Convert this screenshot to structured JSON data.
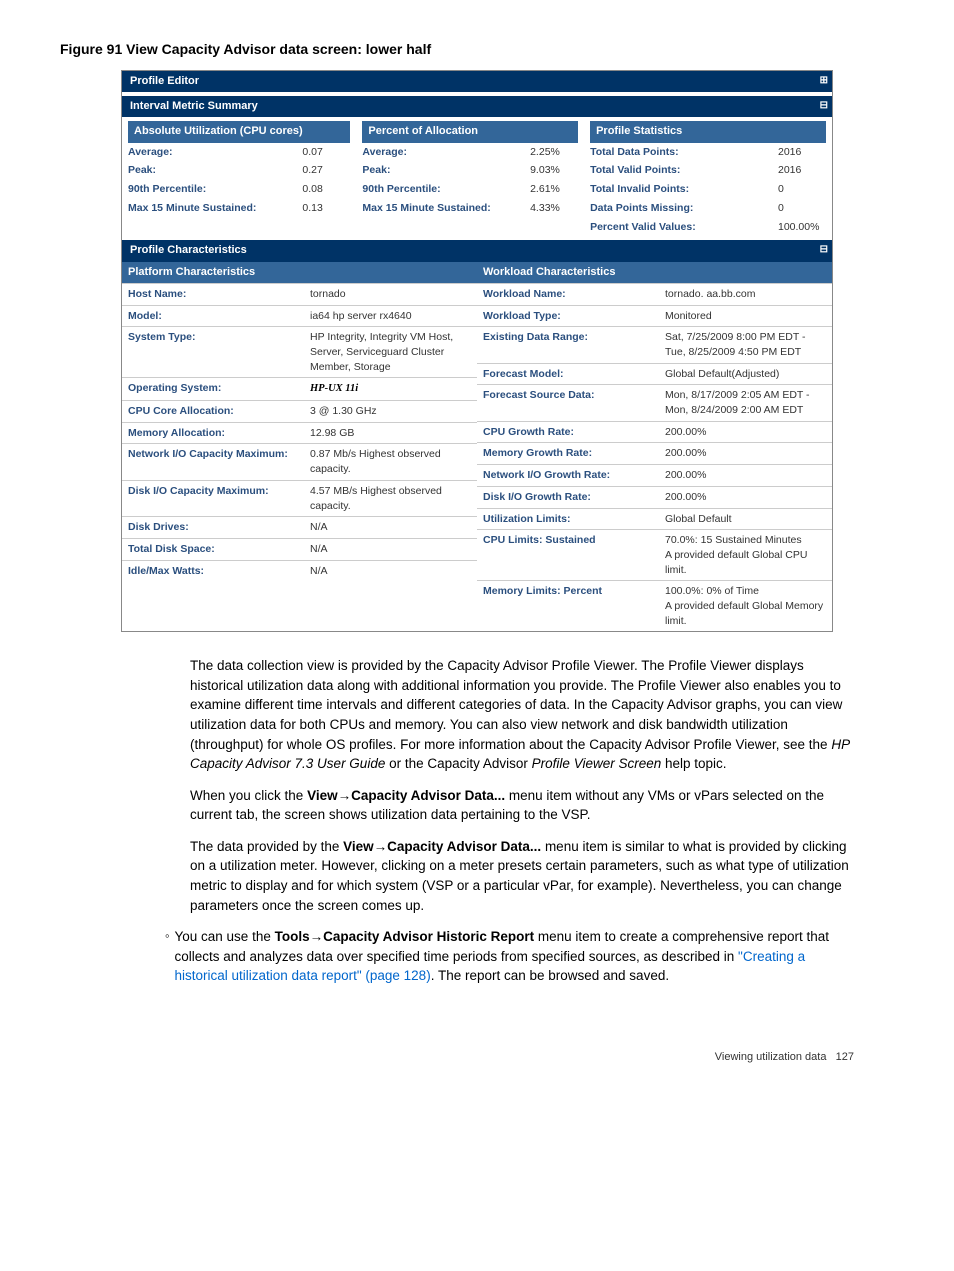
{
  "figure_caption": "Figure 91 View Capacity Advisor data screen: lower half",
  "panels": {
    "profile_editor": {
      "title": "Profile Editor",
      "icon": "plus-icon"
    },
    "interval_metric": {
      "title": "Interval Metric Summary",
      "icon": "minus-icon"
    },
    "profile_char": {
      "title": "Profile Characteristics",
      "icon": "minus-icon"
    }
  },
  "abs_util": {
    "header": "Absolute Utilization (CPU cores)",
    "rows": [
      {
        "label": "Average:",
        "val": "0.07"
      },
      {
        "label": "Peak:",
        "val": "0.27"
      },
      {
        "label": "90th Percentile:",
        "val": "0.08"
      },
      {
        "label": "Max 15 Minute Sustained:",
        "val": "0.13"
      }
    ]
  },
  "pct_alloc": {
    "header": "Percent of Allocation",
    "rows": [
      {
        "label": "Average:",
        "val": "2.25%"
      },
      {
        "label": "Peak:",
        "val": "9.03%"
      },
      {
        "label": "90th Percentile:",
        "val": "2.61%"
      },
      {
        "label": "Max 15 Minute Sustained:",
        "val": "4.33%"
      }
    ]
  },
  "profile_stats": {
    "header": "Profile Statistics",
    "rows": [
      {
        "label": "Total Data Points:",
        "val": "2016"
      },
      {
        "label": "Total Valid Points:",
        "val": "2016"
      },
      {
        "label": "Total Invalid Points:",
        "val": "0"
      },
      {
        "label": "Data Points Missing:",
        "val": "0"
      },
      {
        "label": "Percent Valid Values:",
        "val": "100.00%"
      }
    ]
  },
  "platform_char": {
    "header": "Platform Characteristics",
    "rows": [
      {
        "label": "Host Name:",
        "val": "tornado"
      },
      {
        "label": "Model:",
        "val": "ia64 hp server rx4640"
      },
      {
        "label": "System Type:",
        "val": "HP Integrity, Integrity VM Host, Server, Serviceguard Cluster Member, Storage"
      },
      {
        "label": "Operating System:",
        "val": "HP-UX 11i"
      },
      {
        "label": "CPU Core Allocation:",
        "val": "3 @ 1.30 GHz"
      },
      {
        "label": "Memory Allocation:",
        "val": "12.98 GB"
      },
      {
        "label": "Network I/O Capacity Maximum:",
        "val": "0.87 Mb/s Highest observed capacity."
      },
      {
        "label": "Disk I/O Capacity Maximum:",
        "val": "4.57 MB/s Highest observed capacity."
      },
      {
        "label": "Disk Drives:",
        "val": "N/A"
      },
      {
        "label": "Total Disk Space:",
        "val": "N/A"
      },
      {
        "label": "Idle/Max Watts:",
        "val": "N/A"
      }
    ]
  },
  "workload_char": {
    "header": "Workload Characteristics",
    "rows": [
      {
        "label": "Workload Name:",
        "val": "tornado. aa.bb.com"
      },
      {
        "label": "Workload Type:",
        "val": "Monitored"
      },
      {
        "label": "Existing Data Range:",
        "val": "Sat, 7/25/2009 8:00 PM EDT - Tue, 8/25/2009 4:50 PM EDT"
      },
      {
        "label": "Forecast Model:",
        "val": "Global Default(Adjusted)"
      },
      {
        "label": "Forecast Source Data:",
        "val": "Mon, 8/17/2009 2:05 AM EDT - Mon, 8/24/2009 2:00 AM EDT"
      },
      {
        "label": "CPU Growth Rate:",
        "val": "200.00%"
      },
      {
        "label": "Memory Growth Rate:",
        "val": "200.00%"
      },
      {
        "label": "Network I/O Growth Rate:",
        "val": "200.00%"
      },
      {
        "label": "Disk I/O Growth Rate:",
        "val": "200.00%"
      },
      {
        "label": "Utilization Limits:",
        "val": "Global Default"
      },
      {
        "label": "CPU Limits:   Sustained",
        "val": "70.0%:   15 Sustained Minutes\nA provided default Global CPU limit."
      },
      {
        "label": "Memory Limits:   Percent",
        "val": "100.0%:   0% of Time\nA provided default Global Memory limit."
      }
    ]
  },
  "body": {
    "p1a": "The data collection view is provided by the Capacity Advisor Profile Viewer. The Profile Viewer displays historical utilization data along with additional information you provide. The Profile Viewer also enables you to examine different time intervals and different categories of data. In the Capacity Advisor graphs, you can view utilization data for both CPUs and memory. You can also view network and disk bandwidth utilization (throughput) for whole OS profiles. For more information about the Capacity Advisor Profile Viewer, see the ",
    "p1_ital1": "HP Capacity Advisor 7.3 User Guide",
    "p1b": " or the Capacity Advisor ",
    "p1_ital2": "Profile Viewer Screen",
    "p1c": " help topic.",
    "p2a": "When you click the ",
    "p2_bold": "View→Capacity Advisor Data...",
    "p2b": " menu item without any VMs or vPars selected on the current tab, the screen shows utilization data pertaining to the VSP.",
    "p3a": "The data provided by the ",
    "p3_bold": "View→Capacity Advisor Data...",
    "p3b": " menu item is similar to what is provided by clicking on a utilization meter. However, clicking on a meter presets certain parameters, such as what type of utilization metric to display and for which system (VSP or a particular vPar, for example). Nevertheless, you can change parameters once the screen comes up.",
    "bullet_a": "You can use the ",
    "bullet_bold": "Tools→Capacity Advisor Historic Report",
    "bullet_b": " menu item to create a comprehensive report that collects and analyzes data over specified time periods from specified sources, as described in ",
    "bullet_link": "\"Creating a historical utilization data report\" (page 128)",
    "bullet_c": ". The report can be browsed and saved."
  },
  "footer": {
    "text": "Viewing utilization data",
    "page": "127"
  }
}
